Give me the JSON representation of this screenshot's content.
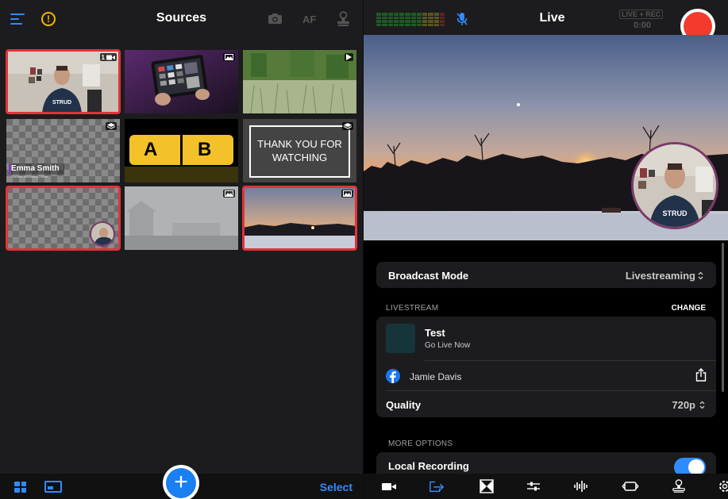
{
  "left": {
    "title": "Sources",
    "af_label": "AF",
    "select_label": "Select",
    "tiles": [
      {
        "name": "camera-tile",
        "badge_number": "1",
        "selected": true
      },
      {
        "name": "tablet-image-tile",
        "selected": false
      },
      {
        "name": "grass-video-tile",
        "selected": false
      },
      {
        "name": "lower-third-tile",
        "overlay_text": "Emma Smith",
        "overlay_subtext": "Creative Marketing Officer",
        "selected": false
      },
      {
        "name": "ab-tile",
        "letter_a": "A",
        "letter_b": "B",
        "selected": false
      },
      {
        "name": "thank-you-tile",
        "text": "THANK YOU FOR WATCHING",
        "selected": false
      },
      {
        "name": "pip-overlay-tile",
        "selected": true
      },
      {
        "name": "foggy-town-image-tile",
        "selected": false
      },
      {
        "name": "sunset-image-tile",
        "selected": true
      }
    ]
  },
  "right": {
    "title": "Live",
    "live_rec_badge": "LIVE + REC",
    "timer": "0:00",
    "broadcast_mode": {
      "label": "Broadcast Mode",
      "value": "Livestreaming"
    },
    "livestream": {
      "section_label": "LIVESTREAM",
      "change_label": "CHANGE",
      "event_title": "Test",
      "event_subtitle": "Go Live Now",
      "account_name": "Jamie Davis",
      "quality_label": "Quality",
      "quality_value": "720p"
    },
    "more_options": {
      "section_label": "MORE OPTIONS",
      "local_recording_label": "Local Recording",
      "local_recording_on": true
    }
  },
  "colors": {
    "accent": "#2f8cff",
    "record": "#f23b2c",
    "selected_outline": "#e0333a",
    "panel": "#1c1c1e"
  },
  "icons": [
    "menu-icon",
    "warning-icon",
    "camera-icon",
    "stamp-icon",
    "grid-view-icon",
    "layout-icon",
    "plus-icon",
    "mic-icon",
    "video-camera-icon",
    "share-out-icon",
    "transition-icon",
    "sliders-icon",
    "waveform-icon",
    "switch-camera-icon",
    "stamp-icon",
    "gear-icon",
    "facebook-icon",
    "share-icon",
    "updown-chevron-icon"
  ]
}
